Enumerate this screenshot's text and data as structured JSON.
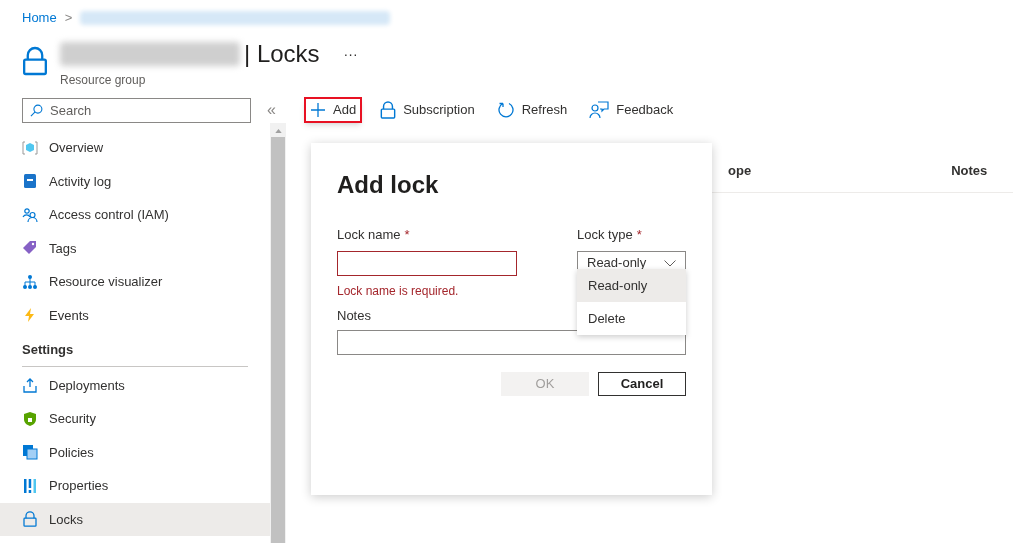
{
  "breadcrumb": {
    "home": "Home",
    "separator": ">"
  },
  "header": {
    "title": "| Locks",
    "subtitle": "Resource group",
    "more": "···"
  },
  "sidebar": {
    "search": {
      "placeholder": "Search"
    },
    "collapse": "«",
    "items": [
      {
        "label": "Overview",
        "selected": false
      },
      {
        "label": "Activity log",
        "selected": false
      },
      {
        "label": "Access control (IAM)",
        "selected": false
      },
      {
        "label": "Tags",
        "selected": false
      },
      {
        "label": "Resource visualizer",
        "selected": false
      },
      {
        "label": "Events",
        "selected": false
      }
    ],
    "section": "Settings",
    "settings_items": [
      {
        "label": "Deployments",
        "selected": false
      },
      {
        "label": "Security",
        "selected": false
      },
      {
        "label": "Policies",
        "selected": false
      },
      {
        "label": "Properties",
        "selected": false
      },
      {
        "label": "Locks",
        "selected": true
      }
    ]
  },
  "toolbar": [
    {
      "label": "Add",
      "highlighted": true
    },
    {
      "label": "Subscription",
      "highlighted": false
    },
    {
      "label": "Refresh",
      "highlighted": false
    },
    {
      "label": "Feedback",
      "highlighted": false
    }
  ],
  "table": {
    "columns": [
      "ope",
      "Notes"
    ]
  },
  "add_lock": {
    "title": "Add lock",
    "lock_name": {
      "label": "Lock name",
      "required_marker": "*",
      "error": "Lock name is required."
    },
    "lock_type": {
      "label": "Lock type",
      "required_marker": "*",
      "value": "Read-only",
      "options": [
        {
          "label": "Read-only",
          "selected": true
        },
        {
          "label": "Delete",
          "selected": false
        }
      ]
    },
    "notes": {
      "label": "Notes"
    },
    "buttons": [
      {
        "label": "OK",
        "disabled": true
      },
      {
        "label": "Cancel",
        "disabled": false
      }
    ]
  }
}
